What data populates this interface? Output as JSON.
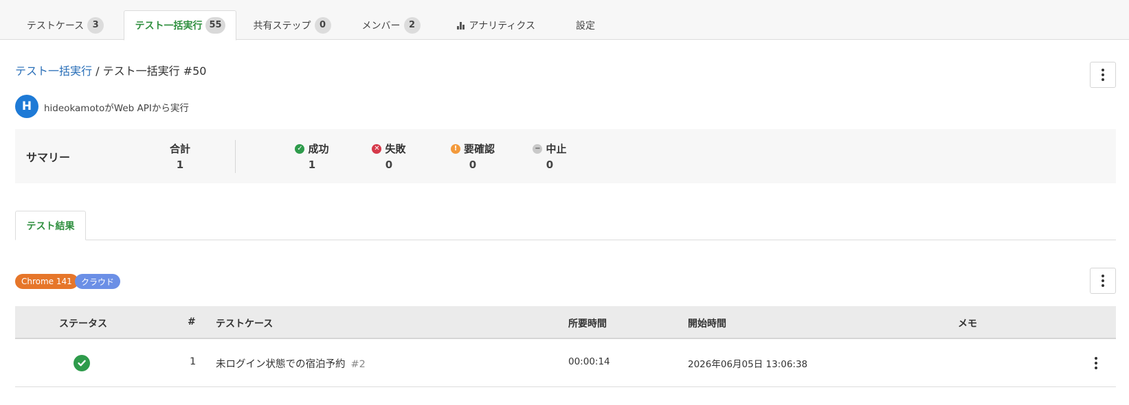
{
  "tabs": [
    {
      "label": "テストケース",
      "count": "3"
    },
    {
      "label": "テスト一括実行",
      "count": "55"
    },
    {
      "label": "共有ステップ",
      "count": "0"
    },
    {
      "label": "メンバー",
      "count": "2"
    },
    {
      "label": "アナリティクス"
    },
    {
      "label": "設定"
    }
  ],
  "breadcrumb": {
    "parent": "テスト一括実行",
    "separator": " / ",
    "current": "テスト一括実行 #50"
  },
  "executor": {
    "avatar_initial": "H",
    "text": "hideokamotoがWeb APIから実行"
  },
  "summary": {
    "title": "サマリー",
    "total": {
      "label": "合計",
      "value": "1"
    },
    "passed": {
      "label": "成功",
      "value": "1",
      "icon": "check-circle-icon",
      "color": "#2e9b4b"
    },
    "failed": {
      "label": "失敗",
      "value": "0",
      "icon": "x-circle-icon",
      "color": "#d6394a"
    },
    "warning": {
      "label": "要確認",
      "value": "0",
      "icon": "exclamation-circle-icon",
      "color": "#f39a3c"
    },
    "aborted": {
      "label": "中止",
      "value": "0",
      "icon": "minus-circle-icon",
      "color": "#c9c9c9"
    }
  },
  "result_tab": {
    "label": "テスト結果"
  },
  "tags": {
    "browser": "Chrome 141",
    "environment": "クラウド"
  },
  "table": {
    "headers": {
      "status": "ステータス",
      "number": "#",
      "test_case": "テストケース",
      "duration": "所要時間",
      "start_time": "開始時間",
      "memo": "メモ"
    },
    "rows": [
      {
        "status": "passed",
        "number": "1",
        "test_case": "未ログイン状態での宿泊予約",
        "case_id": "#2",
        "duration": "00:00:14",
        "start_time": "2026年06月05日 13:06:38",
        "memo": ""
      }
    ]
  },
  "colors": {
    "accent_green": "#2f8f3f",
    "link_blue": "#2a6fb8",
    "avatar_blue": "#1e7ad6",
    "chrome_tag": "#e6762a",
    "cloud_tag": "#6b8fe6"
  }
}
